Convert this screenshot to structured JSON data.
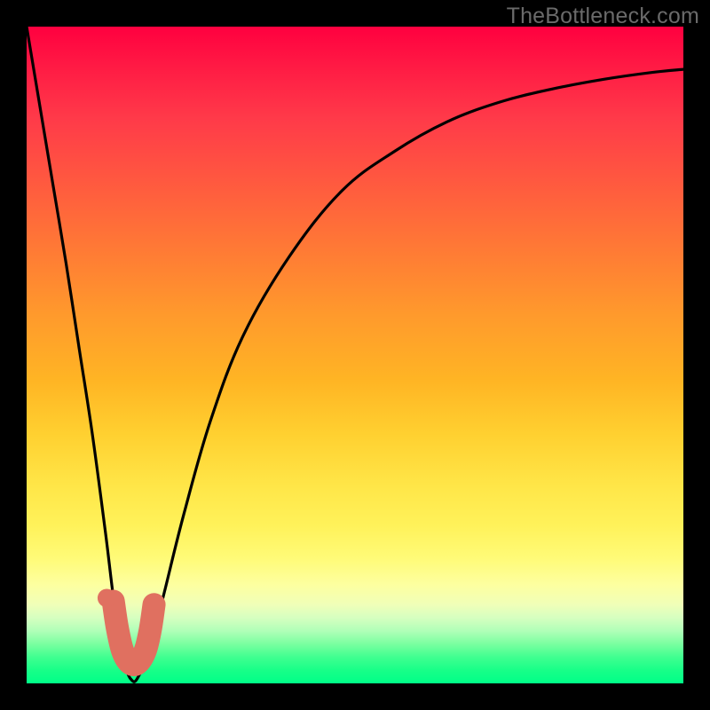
{
  "watermark": "TheBottleneck.com",
  "palette": {
    "frame": "#000000",
    "curve": "#000000",
    "marker_fill": "#e07060",
    "marker_stroke": "#c05848"
  },
  "chart_data": {
    "type": "line",
    "title": "",
    "xlabel": "",
    "ylabel": "",
    "xlim": [
      0,
      100
    ],
    "ylim": [
      0,
      100
    ],
    "grid": false,
    "series": [
      {
        "name": "bottleneck-curve",
        "x": [
          0,
          2,
          4,
          6,
          8,
          10,
          12,
          13.5,
          15,
          16,
          17,
          19,
          21,
          24,
          28,
          33,
          40,
          48,
          56,
          64,
          72,
          80,
          88,
          95,
          100
        ],
        "y": [
          100,
          88,
          76,
          64,
          51,
          38,
          23,
          11,
          3,
          0.5,
          1,
          6,
          14,
          26,
          40,
          53,
          65,
          75,
          81,
          85.5,
          88.5,
          90.5,
          92,
          93,
          93.5
        ]
      }
    ],
    "markers": {
      "dip_path": [
        {
          "x": 13.2,
          "y": 12.5
        },
        {
          "x": 13.8,
          "y": 8.5
        },
        {
          "x": 14.6,
          "y": 5.0
        },
        {
          "x": 15.6,
          "y": 3.2
        },
        {
          "x": 16.8,
          "y": 3.0
        },
        {
          "x": 18.0,
          "y": 4.8
        },
        {
          "x": 18.8,
          "y": 8.0
        },
        {
          "x": 19.4,
          "y": 12.0
        }
      ],
      "dot": {
        "x": 12.2,
        "y": 13.0,
        "r_pct": 1.4
      }
    }
  }
}
